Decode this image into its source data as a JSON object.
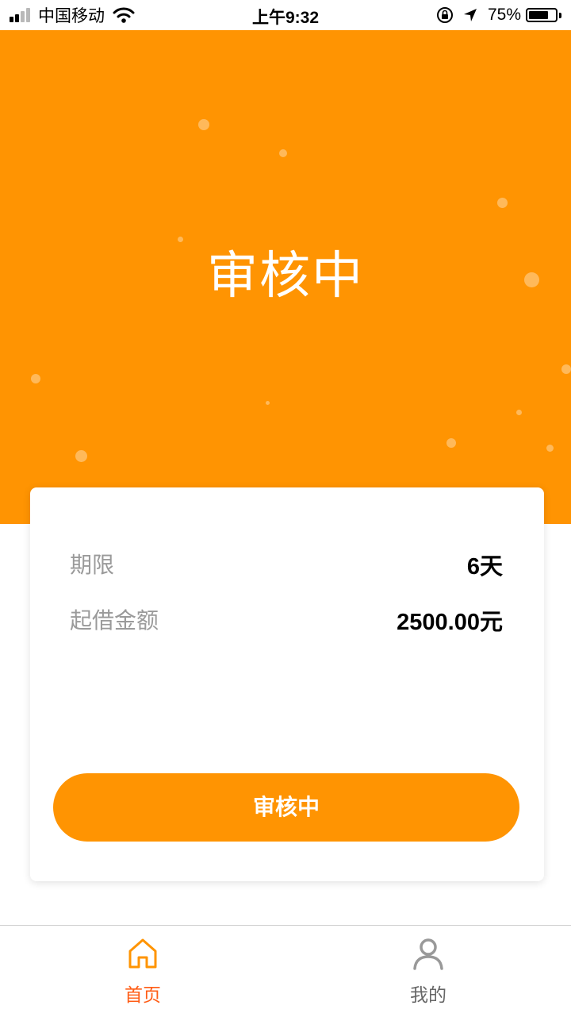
{
  "status_bar": {
    "carrier": "中国移动",
    "time": "上午9:32",
    "battery": "75%",
    "battery_level": 0.75,
    "icons": [
      "signal-icon",
      "wifi-icon",
      "orientation-lock-icon",
      "location-icon",
      "battery-icon"
    ]
  },
  "hero": {
    "title": "审核中",
    "background_color": "#ff9402"
  },
  "card": {
    "rows": [
      {
        "label": "期限",
        "value": "6天"
      },
      {
        "label": "起借金额",
        "value": "2500.00元"
      }
    ],
    "button_label": "审核中",
    "button_color": "#ff9402"
  },
  "tabbar": {
    "items": [
      {
        "label": "首页",
        "icon": "home-icon",
        "active": true,
        "color": "#ff5d16"
      },
      {
        "label": "我的",
        "icon": "user-icon",
        "active": false,
        "color": "#666666"
      }
    ]
  }
}
